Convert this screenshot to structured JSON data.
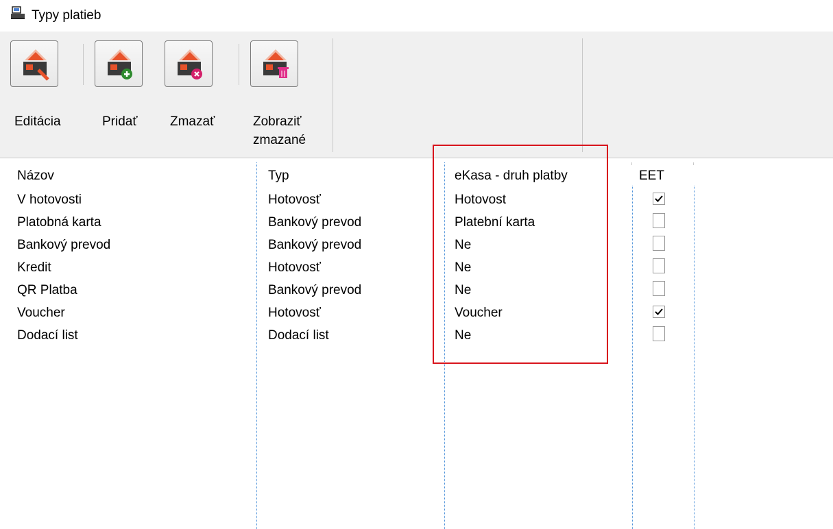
{
  "window": {
    "title": "Typy platieb",
    "icon": "cash-register-icon"
  },
  "toolbar": {
    "buttons": [
      {
        "label": "Editácia",
        "icon": "edit-payment-icon"
      },
      {
        "label": "Pridať",
        "icon": "add-payment-icon"
      },
      {
        "label": "Zmazať",
        "icon": "delete-payment-icon"
      },
      {
        "label_line1": "Zobraziť",
        "label_line2": "zmazané",
        "icon": "show-deleted-payment-icon"
      }
    ]
  },
  "table": {
    "columns": [
      "Názov",
      "Typ",
      "eKasa - druh platby",
      "EET"
    ],
    "rows": [
      {
        "name": "V hotovosti",
        "type": "Hotovosť",
        "ekasa": "Hotovost",
        "eet": true
      },
      {
        "name": "Platobná karta",
        "type": "Bankový prevod",
        "ekasa": "Platební karta",
        "eet": false
      },
      {
        "name": "Bankový prevod",
        "type": "Bankový prevod",
        "ekasa": "Ne",
        "eet": false
      },
      {
        "name": "Kredit",
        "type": "Hotovosť",
        "ekasa": "Ne",
        "eet": false
      },
      {
        "name": "QR Platba",
        "type": "Bankový prevod",
        "ekasa": "Ne",
        "eet": false
      },
      {
        "name": "Voucher",
        "type": "Hotovosť",
        "ekasa": "Voucher",
        "eet": true
      },
      {
        "name": "Dodací list",
        "type": "Dodací list",
        "ekasa": "Ne",
        "eet": false
      }
    ]
  },
  "colors": {
    "highlight": "#d8141c",
    "icon_accent": "#e8522a",
    "gridline": "#4a90d9"
  }
}
